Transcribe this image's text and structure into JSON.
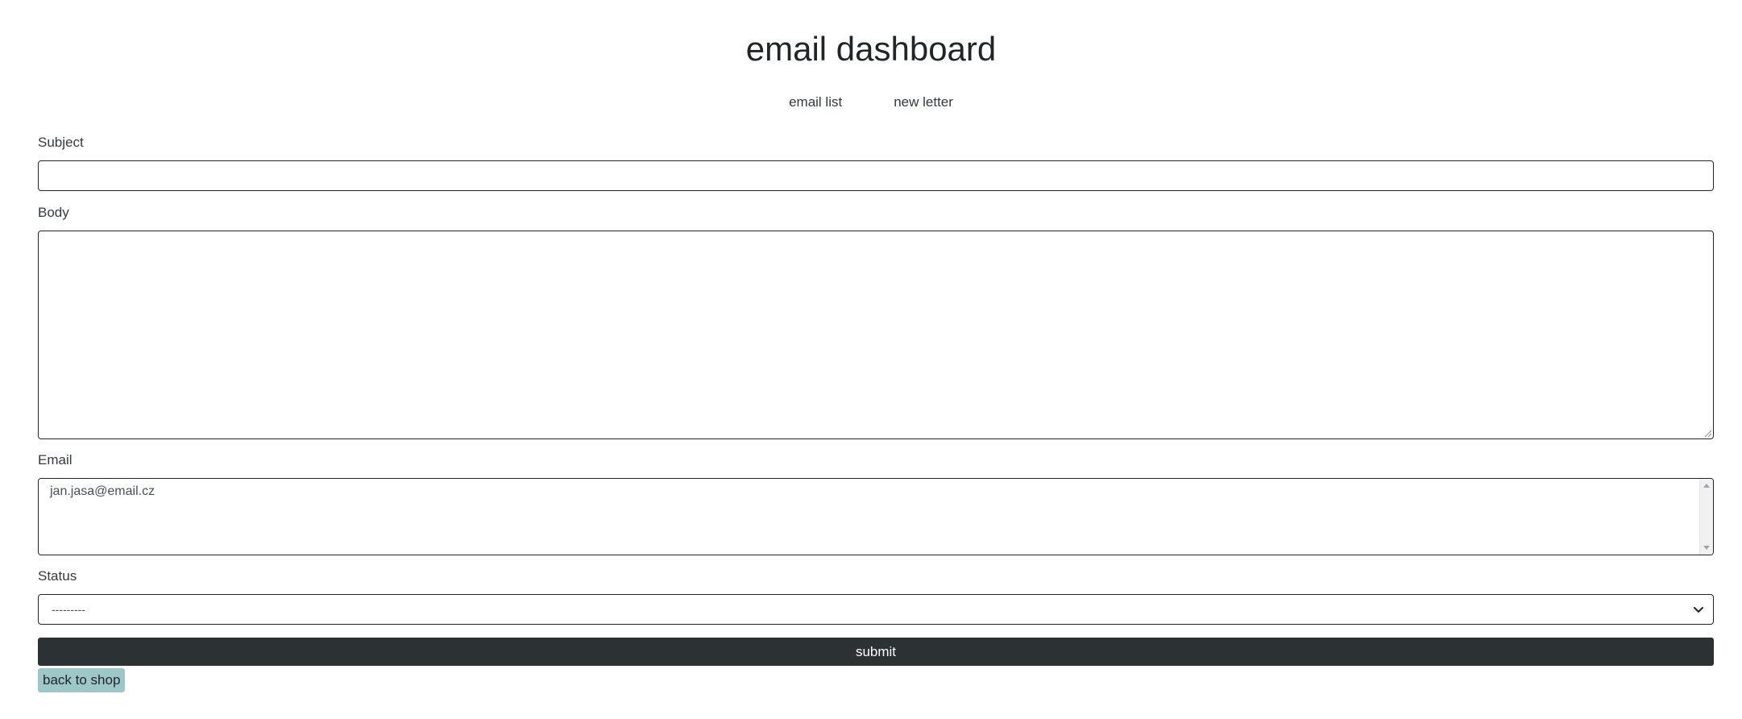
{
  "header": {
    "title": "email dashboard"
  },
  "nav": {
    "items": [
      {
        "label": "email list"
      },
      {
        "label": "new letter"
      }
    ]
  },
  "form": {
    "subject": {
      "label": "Subject",
      "value": ""
    },
    "body": {
      "label": "Body",
      "value": ""
    },
    "email": {
      "label": "Email",
      "options": [
        "jan.jasa@email.cz"
      ]
    },
    "status": {
      "label": "Status",
      "selected": "---------"
    },
    "submit_label": "submit"
  },
  "footer": {
    "back_label": "back to shop"
  },
  "colors": {
    "submit_bg": "#2c3133",
    "back_bg": "#9ec8c7"
  }
}
